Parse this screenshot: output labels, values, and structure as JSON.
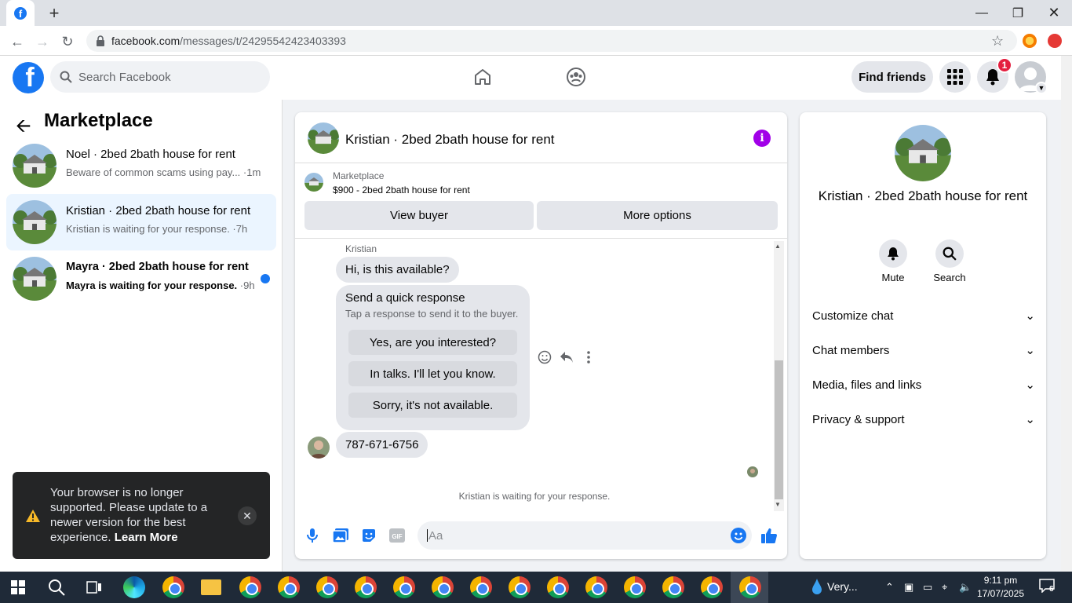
{
  "browser": {
    "url_host": "facebook.com",
    "url_path": "/messages/t/24295542423403393",
    "new_tab_label": "+"
  },
  "header": {
    "search_placeholder": "Search Facebook",
    "find_friends": "Find friends",
    "notification_count": "1"
  },
  "sidebar": {
    "title": "Marketplace",
    "conversations": [
      {
        "title": "Noel · 2bed 2bath house for rent",
        "subtitle": "Beware of common scams using pay...",
        "time": " ·1m",
        "selected": false,
        "unread": false
      },
      {
        "title": "Kristian · 2bed 2bath house for rent",
        "subtitle": "Kristian is waiting for your response.",
        "time": " ·7h",
        "selected": true,
        "unread": false
      },
      {
        "title": "Mayra · 2bed 2bath house for rent",
        "subtitle": "Mayra is waiting for your response.",
        "time": " ·9h",
        "selected": false,
        "unread": true
      }
    ]
  },
  "toast": {
    "message": "Your browser is no longer supported. Please update to a newer version for the best experience.",
    "link": "Learn More"
  },
  "chat": {
    "title": "Kristian · 2bed 2bath house for rent",
    "listing_source": "Marketplace",
    "listing_summary": "$900 - 2bed 2bath house for rent",
    "view_buyer": "View buyer",
    "more_options": "More options",
    "sender_name": "Kristian",
    "first_message": "Hi, is this available?",
    "quick_response": {
      "title": "Send a quick response",
      "subtitle": "Tap a response to send it to the buyer.",
      "options": [
        "Yes, are you interested?",
        "In talks. I'll let you know.",
        "Sorry, it's not available."
      ]
    },
    "phone_message": "787-671-6756",
    "status": "Kristian is waiting for your response.",
    "composer_placeholder": "Aa"
  },
  "details": {
    "name": "Kristian · 2bed 2bath house for rent",
    "mute_label": "Mute",
    "search_label": "Search",
    "sections": [
      "Customize chat",
      "Chat members",
      "Media, files and links",
      "Privacy & support"
    ]
  },
  "taskbar": {
    "weather": "Very...",
    "time": "9:11 pm",
    "date": "17/07/2025",
    "notification_count": "6"
  },
  "colors": {
    "fb_blue": "#1877f2",
    "info_purple": "#a100e8",
    "selected_row": "#ebf5ff",
    "badge_red": "#e41e3f"
  }
}
